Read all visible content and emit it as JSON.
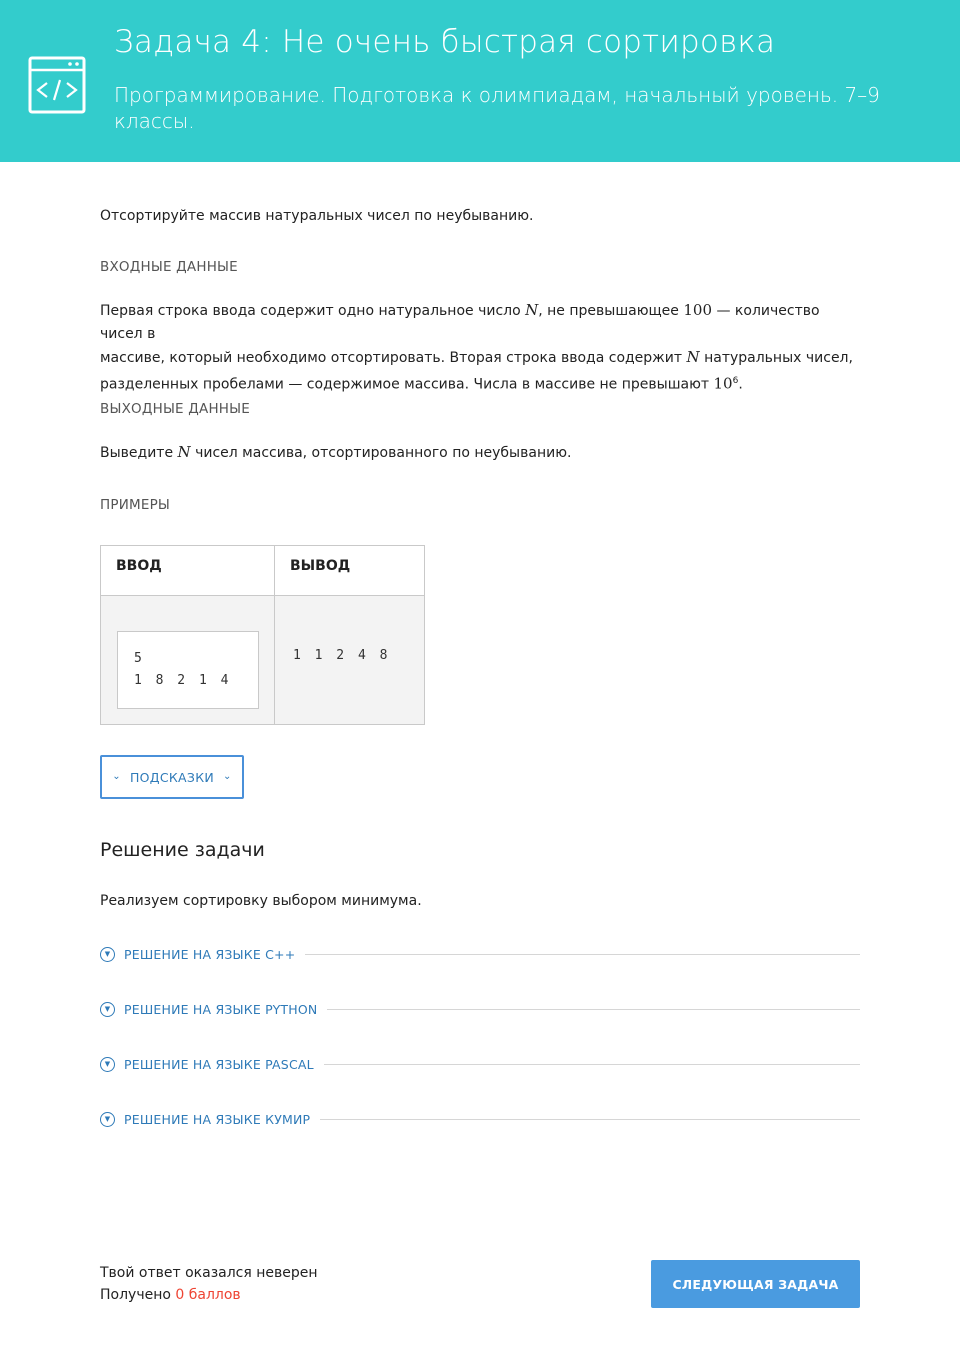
{
  "header": {
    "title": "Задача 4: Не очень быстрая сортировка",
    "subtitle": "Программирование. Подготовка к олимпиадам, начальный уровень. 7–9 классы.",
    "icon": "code-window-icon"
  },
  "task": {
    "statement": "Отсортируйте массив натуральных чисел по неубыванию.",
    "input_heading": "ВХОДНЫЕ ДАННЫЕ",
    "input_text": {
      "line1_a": "Первая строка ввода содержит одно натуральное число ",
      "var_n": "N",
      "line1_b": ", не превышающее ",
      "num_100": "100",
      "line1_c": " — количество чисел в",
      "line2_a": "массиве, который необходимо отсортировать. Вторая строка ввода содержит ",
      "line2_b": " натуральных чисел,",
      "line3_a": "разделенных пробелами — содержимое массива. Числа в массиве не превышают ",
      "num_10": "10",
      "exp_6": "6",
      "line3_b": "."
    },
    "output_heading": "ВЫХОДНЫЕ ДАННЫЕ",
    "output_text": {
      "a": "Выведите ",
      "var_n": "N",
      "b": " чисел массива, отсортированного по неубыванию."
    },
    "examples_heading": "ПРИМЕРЫ",
    "examples": {
      "col_input": "ВВОД",
      "col_output": "ВЫВОД",
      "input_line1": "5",
      "input_line2": "1 8 2 1 4",
      "output_line1": "1 1 2 4 8"
    },
    "hints_label": "ПОДСКАЗКИ"
  },
  "solution": {
    "title": "Решение задачи",
    "text": "Реализуем сортировку выбором минимума.",
    "accordions": [
      {
        "label": "РЕШЕНИЕ НА ЯЗЫКЕ C++"
      },
      {
        "label": "РЕШЕНИЕ НА ЯЗЫКЕ PYTHON"
      },
      {
        "label": "РЕШЕНИЕ НА ЯЗЫКЕ PASCAL"
      },
      {
        "label": "РЕШЕНИЕ НА ЯЗЫКЕ КУМИР"
      }
    ]
  },
  "footer": {
    "result_text": "Твой ответ оказался неверен",
    "score_prefix": "Получено ",
    "score_value": "0 баллов",
    "next_button": "СЛЕДУЮЩАЯ ЗАДАЧА"
  },
  "colors": {
    "header_bg": "#33cccc",
    "accent": "#2e7ab8",
    "button_bg": "#4a9be0",
    "error": "#ee4433"
  }
}
